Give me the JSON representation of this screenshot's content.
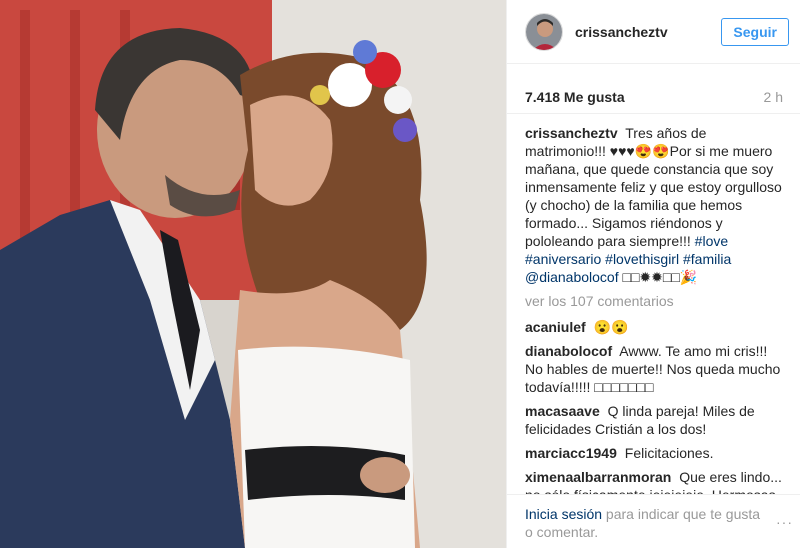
{
  "header": {
    "username": "crissancheztv",
    "follow_label": "Seguir"
  },
  "meta": {
    "likes": "7.418 Me gusta",
    "time": "2 h"
  },
  "caption": {
    "user": "crissancheztv",
    "text": "Tres años de matrimonio!!! ♥♥♥😍😍Por si me muero mañana, que quede constancia que soy inmensamente feliz y que estoy orgulloso (y chocho) de la familia que hemos formado... Sigamos riéndonos y pololeando para siempre!!!",
    "tags": [
      "#love",
      "#aniversario",
      "#lovethisgirl",
      "#familia",
      "@dianabolocof"
    ],
    "tail": "□□✹✹□□🎉"
  },
  "view_comments": "ver los 107 comentarios",
  "comments": [
    {
      "user": "acaniulef",
      "text": "😮😮"
    },
    {
      "user": "dianabolocof",
      "text": "Awww. Te amo mi cris!!! No hables de muerte!! Nos queda mucho todavía!!!!! □□□□□□□"
    },
    {
      "user": "macasaave",
      "text": "Q linda pareja! Miles de felicidades Cristián a los dos!"
    },
    {
      "user": "marciacc1949",
      "text": "Felicitaciones."
    },
    {
      "user": "ximenaalbarranmoran",
      "text": "Que eres lindo... no sólo físicamente jejejejeje. Hermosas tus palabras, te felicito por tu aniversario"
    }
  ],
  "footer": {
    "login_link": "Inicia sesión",
    "login_text": " para indicar que te gusta o comentar.",
    "more_icon": "···"
  },
  "colors": {
    "link": "#003569",
    "follow": "#3897f0",
    "muted": "#999999"
  }
}
